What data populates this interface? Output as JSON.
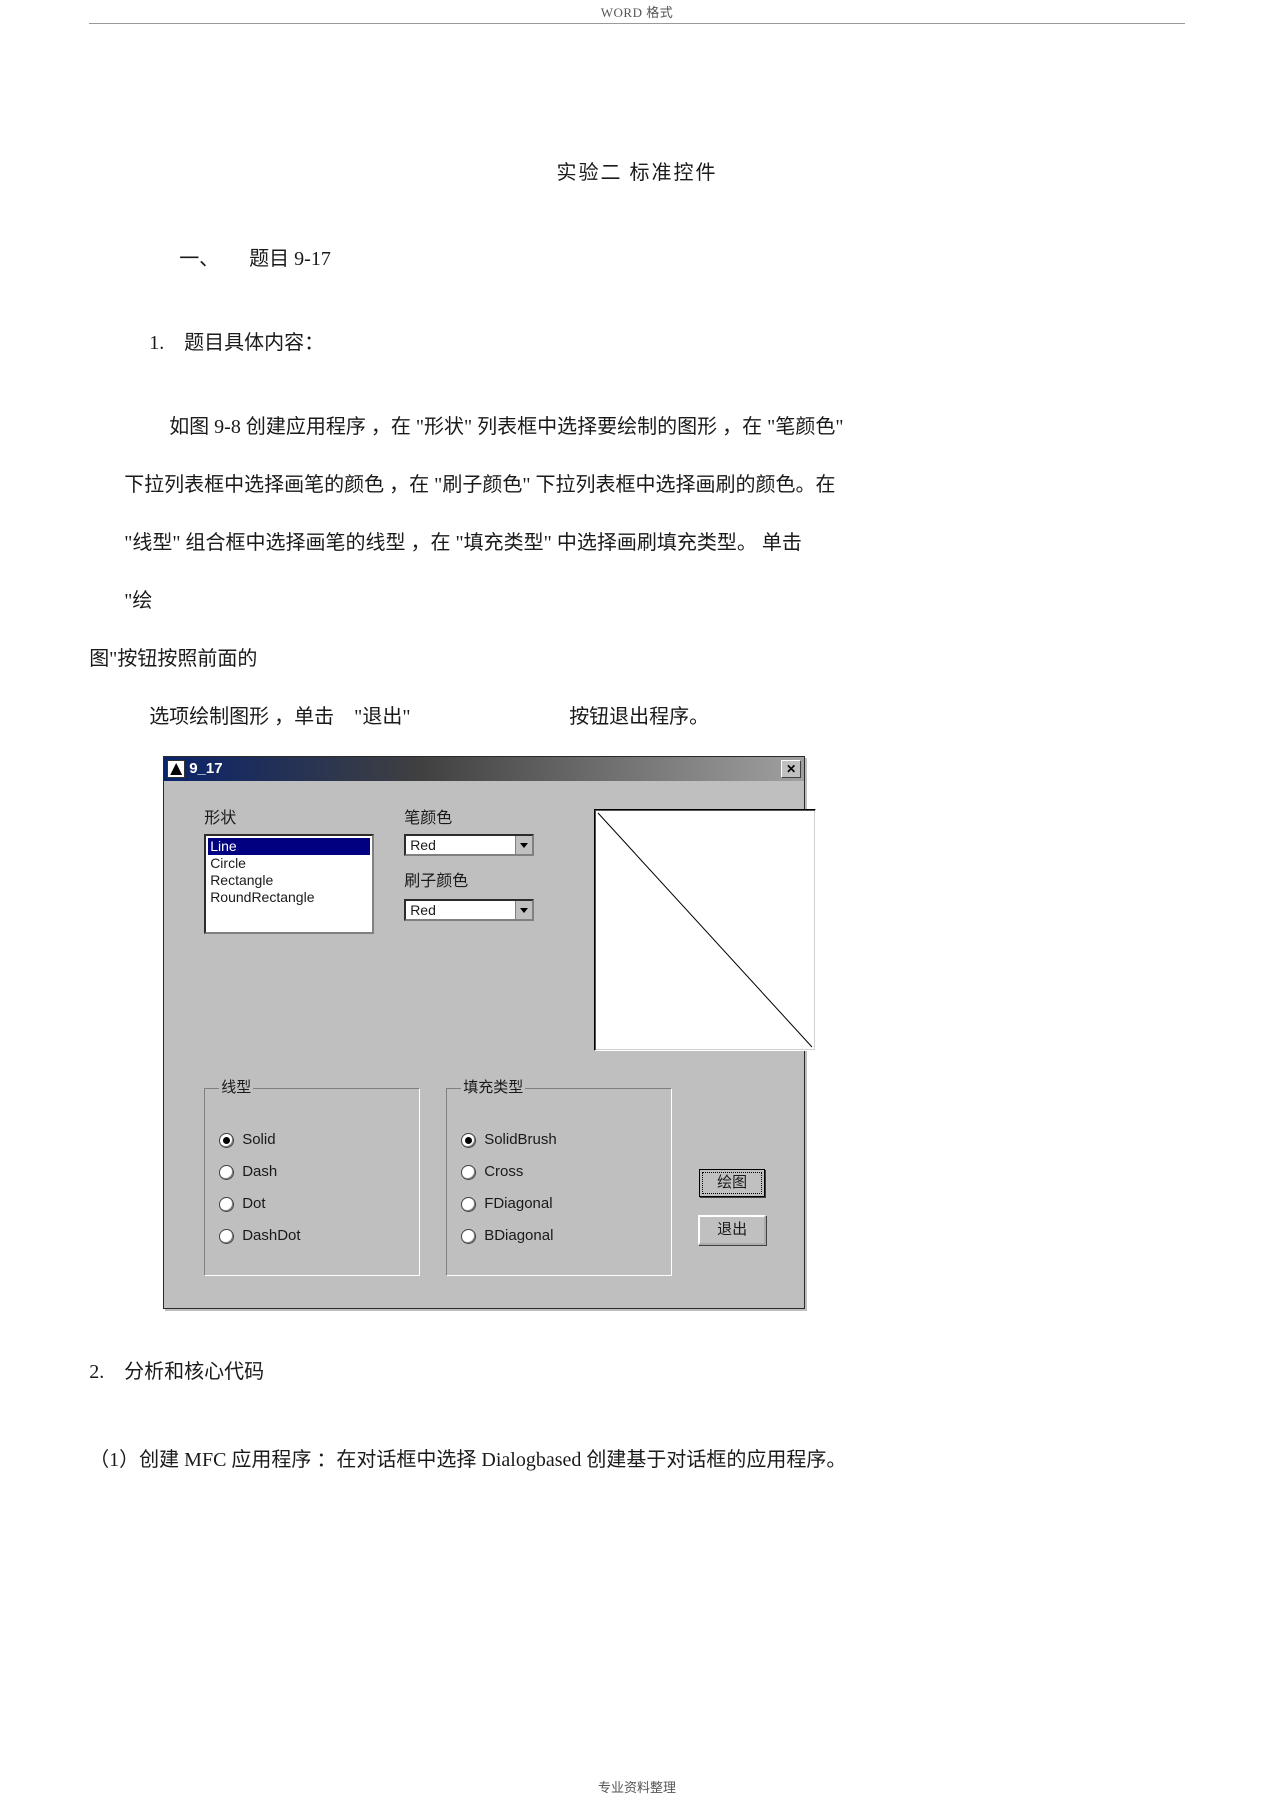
{
  "header": "WORD 格式",
  "footer": "专业资料整理",
  "doc": {
    "title": "实验二 标准控件",
    "section_one": "一、　　题目 9-17",
    "item1_label": "1.　题目具体内容：",
    "para_l1": "如图 9-8 创建应用程序 ，在 \"形状\" 列表框中选择要绘制的图形 ，在 \"笔颜色\"",
    "para_l2": "下拉列表框中选择画笔的颜色 ，在 \"刷子颜色\" 下拉列表框中选择画刷的颜色。在",
    "para_l3": "\"线型\" 组合框中选择画笔的线型 ，在 \"填充类型\" 中选择画刷填充类型。 单击",
    "para_l4": "\"绘",
    "para_l5": "图\"按钮按照前面的",
    "para_l6_left": "选项绘制图形 ，单击　\"退出\"",
    "para_l6_right": "按钮退出程序。",
    "item2_label": "2.　分析和核心代码",
    "step1": "（1）创建 MFC 应用程序 ：在对话框中选择 Dialogbased 创建基于对话框的应用程序。"
  },
  "dialog": {
    "title": "9_17",
    "shape_label": "形状",
    "pen_label": "笔颜色",
    "brush_label": "刷子颜色",
    "line_group": "线型",
    "fill_group": "填充类型",
    "shapes": [
      "Line",
      "Circle",
      "Rectangle",
      "RoundRectangle"
    ],
    "shape_selected": "Line",
    "pen_value": "Red",
    "brush_value": "Red",
    "line_styles": [
      "Solid",
      "Dash",
      "Dot",
      "DashDot"
    ],
    "line_selected": "Solid",
    "fill_styles": [
      "SolidBrush",
      "Cross",
      "FDiagonal",
      "BDiagonal"
    ],
    "fill_selected": "SolidBrush",
    "btn_draw": "绘图",
    "btn_exit": "退出"
  }
}
